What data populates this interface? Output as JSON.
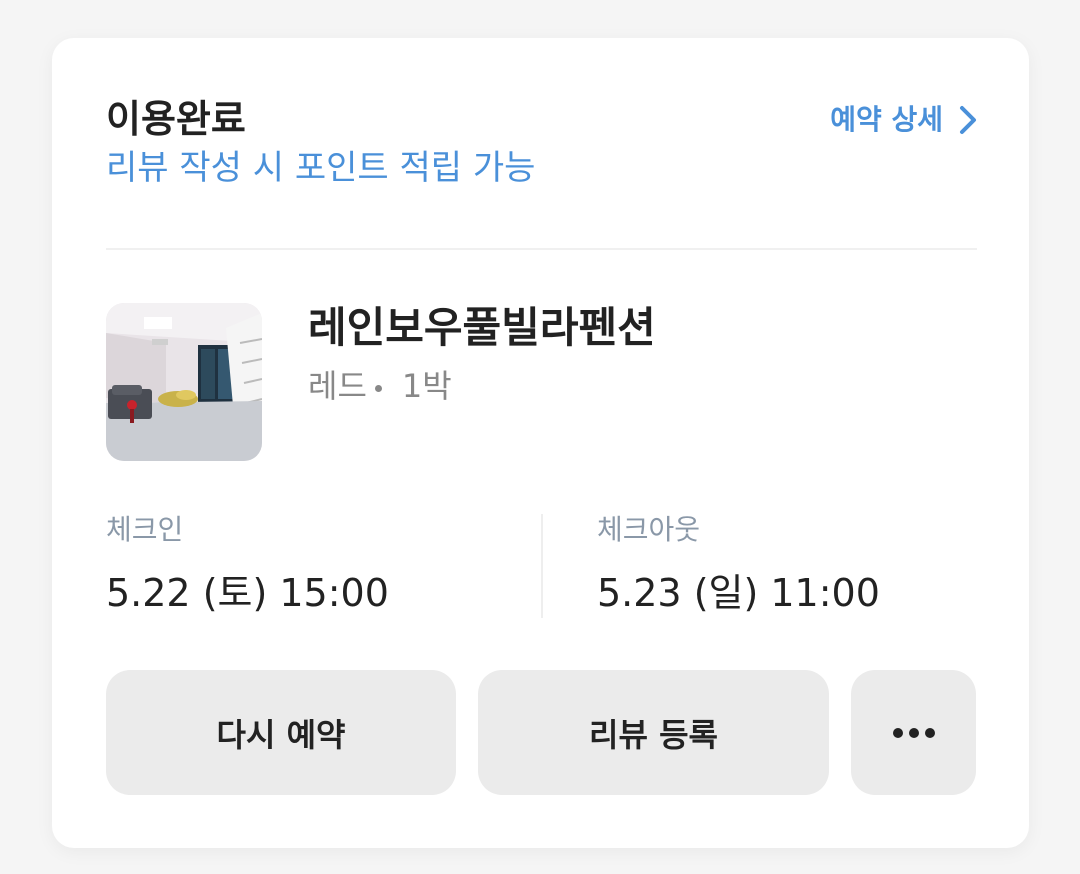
{
  "reservation": {
    "status_title": "이용완료",
    "status_subtitle": "리뷰 작성 시 포인트 적립 가능",
    "detail_link_label": "예약 상세",
    "detail_icon": "chevron-right-icon",
    "accent_color": "#4a90d9"
  },
  "place": {
    "name": "레인보우풀빌라펜션",
    "room": "레드",
    "nights": "1박",
    "thumbnail": "room-photo"
  },
  "checkin": {
    "label": "체크인",
    "value": "5.22 (토) 15:00"
  },
  "checkout": {
    "label": "체크아웃",
    "value": "5.23 (일) 11:00"
  },
  "actions": {
    "rebook_label": "다시 예약",
    "review_label": "리뷰 등록",
    "more_icon": "more-horizontal-icon"
  }
}
